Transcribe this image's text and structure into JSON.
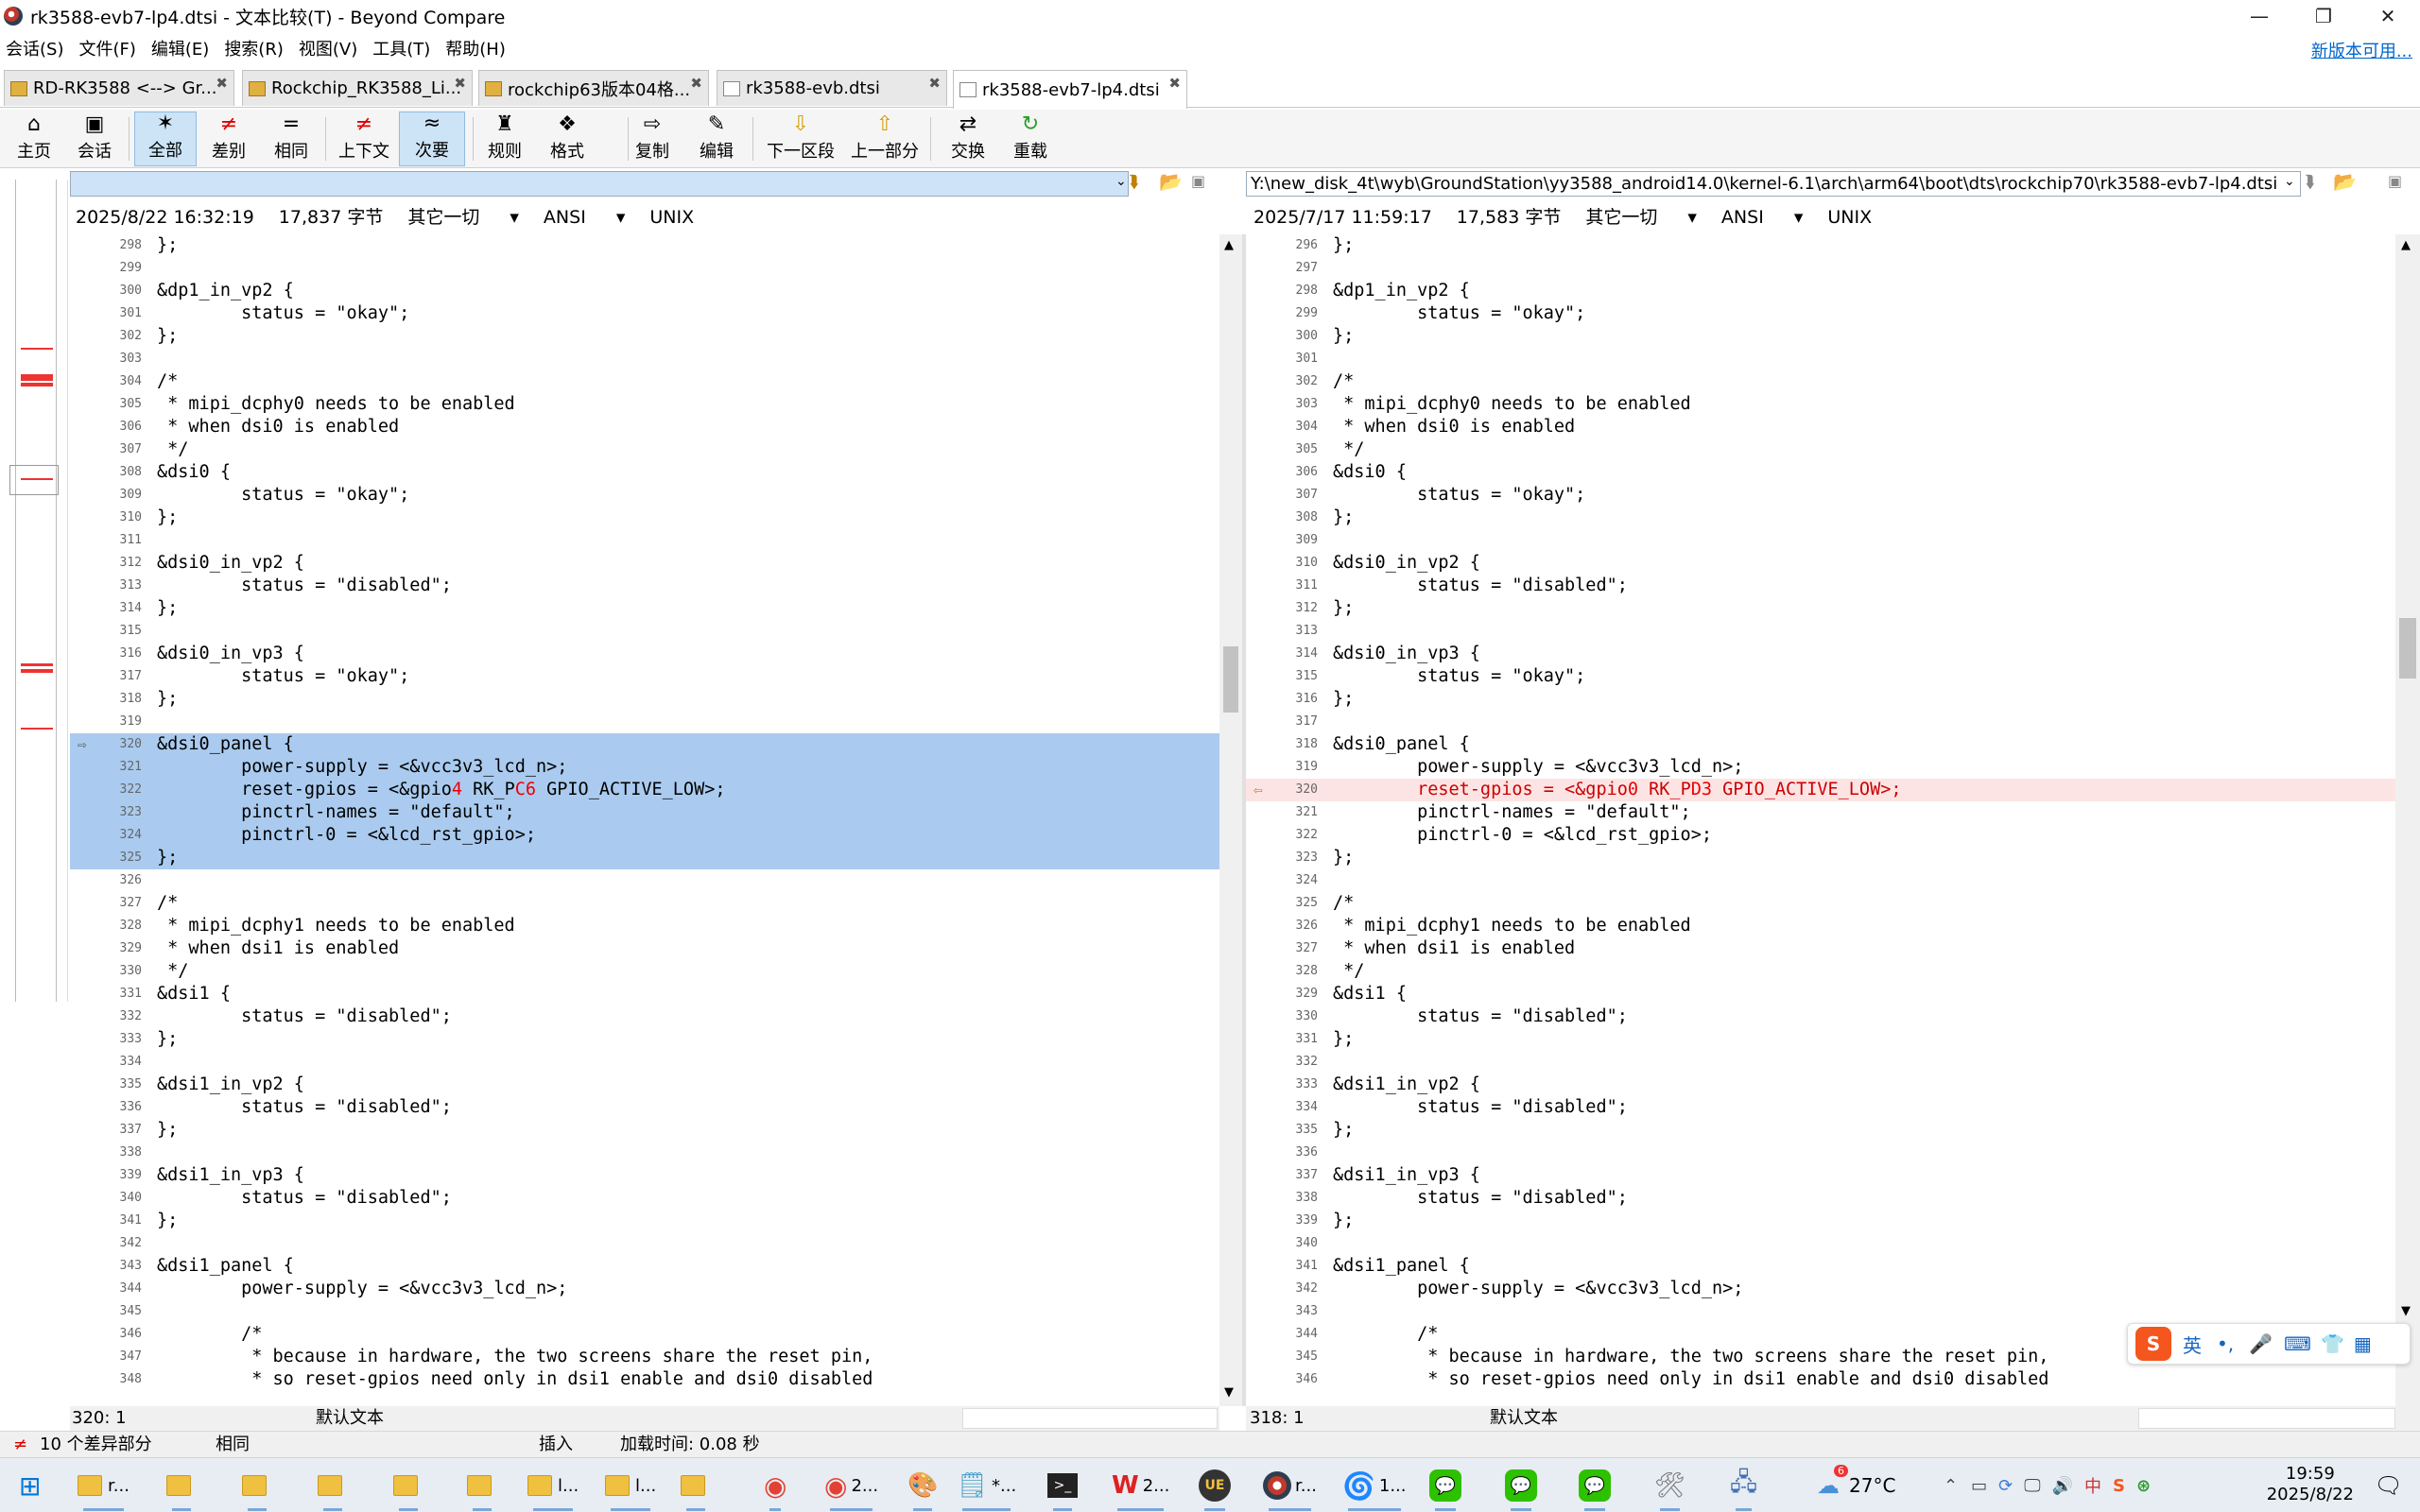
{
  "window": {
    "title": "rk3588-evb7-lp4.dtsi - 文本比较(T) - Beyond Compare"
  },
  "menu": [
    "会话(S)",
    "文件(F)",
    "编辑(E)",
    "搜索(R)",
    "视图(V)",
    "工具(T)",
    "帮助(H)"
  ],
  "update_link": "新版本可用...",
  "tabs": [
    "RD-RK3588 <--> Gr...",
    "Rockchip_RK3588_Li...",
    "rockchip63版本04格...",
    "rk3588-evb.dtsi",
    "rk3588-evb7-lp4.dtsi"
  ],
  "toolbar": [
    {
      "label": "主页",
      "icon": "⌂"
    },
    {
      "label": "会话",
      "icon": "▣"
    },
    {
      "label": "全部",
      "icon": "✶"
    },
    {
      "label": "差别",
      "icon": "≠"
    },
    {
      "label": "相同",
      "icon": "="
    },
    {
      "label": "上下文",
      "icon": "≠"
    },
    {
      "label": "次要",
      "icon": "≈"
    },
    {
      "label": "规则",
      "icon": "♜"
    },
    {
      "label": "格式",
      "icon": "❖"
    },
    {
      "label": "复制",
      "icon": "⇨"
    },
    {
      "label": "编辑",
      "icon": "✎"
    },
    {
      "label": "下一区段",
      "icon": "⇩"
    },
    {
      "label": "上一部分",
      "icon": "⇧"
    },
    {
      "label": "交换",
      "icon": "⇄"
    },
    {
      "label": "重载",
      "icon": "↻"
    }
  ],
  "left": {
    "path": "",
    "date": "2025/8/22 16:32:19",
    "size": "17,837 字节",
    "filter": "其它一切",
    "encoding": "ANSI",
    "eol": "UNIX",
    "pos": "320: 1",
    "mode": "默认文本"
  },
  "right": {
    "path": "Y:\\new_disk_4t\\wyb\\GroundStation\\yy3588_android14.0\\kernel-6.1\\arch\\arm64\\boot\\dts\\rockchip70\\rk3588-evb7-lp4.dtsi",
    "date": "2025/7/17 11:59:17",
    "size": "17,583 字节",
    "filter": "其它一切",
    "encoding": "ANSI",
    "eol": "UNIX",
    "pos": "318: 1",
    "mode": "默认文本"
  },
  "left_lines": [
    {
      "n": "298",
      "t": "};"
    },
    {
      "n": "299",
      "t": ""
    },
    {
      "n": "300",
      "t": "&dp1_in_vp2 {"
    },
    {
      "n": "301",
      "t": "        status = \"okay\";"
    },
    {
      "n": "302",
      "t": "};"
    },
    {
      "n": "303",
      "t": ""
    },
    {
      "n": "304",
      "t": "/*"
    },
    {
      "n": "305",
      "t": " * mipi_dcphy0 needs to be enabled"
    },
    {
      "n": "306",
      "t": " * when dsi0 is enabled"
    },
    {
      "n": "307",
      "t": " */"
    },
    {
      "n": "308",
      "t": "&dsi0 {"
    },
    {
      "n": "309",
      "t": "        status = \"okay\";"
    },
    {
      "n": "310",
      "t": "};"
    },
    {
      "n": "311",
      "t": ""
    },
    {
      "n": "312",
      "t": "&dsi0_in_vp2 {"
    },
    {
      "n": "313",
      "t": "        status = \"disabled\";"
    },
    {
      "n": "314",
      "t": "};"
    },
    {
      "n": "315",
      "t": ""
    },
    {
      "n": "316",
      "t": "&dsi0_in_vp3 {"
    },
    {
      "n": "317",
      "t": "        status = \"okay\";"
    },
    {
      "n": "318",
      "t": "};"
    },
    {
      "n": "319",
      "t": ""
    },
    {
      "n": "320",
      "t": "&dsi0_panel {",
      "sel": true
    },
    {
      "n": "321",
      "t": "        power-supply = <&vcc3v3_lcd_n>;",
      "sel": true
    },
    {
      "n": "322",
      "t": "        reset-gpios = <&gpio",
      "m1": "4",
      "t2": " RK_P",
      "m2": "C6",
      "t3": " GPIO_ACTIVE_LOW>;",
      "sel": true
    },
    {
      "n": "323",
      "t": "        pinctrl-names = \"default\";",
      "sel": true
    },
    {
      "n": "324",
      "t": "        pinctrl-0 = <&lcd_rst_gpio>;",
      "sel": true
    },
    {
      "n": "325",
      "t": "};",
      "sel": true
    },
    {
      "n": "326",
      "t": ""
    },
    {
      "n": "327",
      "t": "/*"
    },
    {
      "n": "328",
      "t": " * mipi_dcphy1 needs to be enabled"
    },
    {
      "n": "329",
      "t": " * when dsi1 is enabled"
    },
    {
      "n": "330",
      "t": " */"
    },
    {
      "n": "331",
      "t": "&dsi1 {"
    },
    {
      "n": "332",
      "t": "        status = \"disabled\";"
    },
    {
      "n": "333",
      "t": "};"
    },
    {
      "n": "334",
      "t": ""
    },
    {
      "n": "335",
      "t": "&dsi1_in_vp2 {"
    },
    {
      "n": "336",
      "t": "        status = \"disabled\";"
    },
    {
      "n": "337",
      "t": "};"
    },
    {
      "n": "338",
      "t": ""
    },
    {
      "n": "339",
      "t": "&dsi1_in_vp3 {"
    },
    {
      "n": "340",
      "t": "        status = \"disabled\";"
    },
    {
      "n": "341",
      "t": "};"
    },
    {
      "n": "342",
      "t": ""
    },
    {
      "n": "343",
      "t": "&dsi1_panel {"
    },
    {
      "n": "344",
      "t": "        power-supply = <&vcc3v3_lcd_n>;"
    },
    {
      "n": "345",
      "t": ""
    },
    {
      "n": "346",
      "t": "        /*"
    },
    {
      "n": "347",
      "t": "         * because in hardware, the two screens share the reset pin,"
    },
    {
      "n": "348",
      "t": "         * so reset-gpios need only in dsi1 enable and dsi0 disabled"
    }
  ],
  "right_lines": [
    {
      "n": "296",
      "t": "};"
    },
    {
      "n": "297",
      "t": ""
    },
    {
      "n": "298",
      "t": "&dp1_in_vp2 {"
    },
    {
      "n": "299",
      "t": "        status = \"okay\";"
    },
    {
      "n": "300",
      "t": "};"
    },
    {
      "n": "301",
      "t": ""
    },
    {
      "n": "302",
      "t": "/*"
    },
    {
      "n": "303",
      "t": " * mipi_dcphy0 needs to be enabled"
    },
    {
      "n": "304",
      "t": " * when dsi0 is enabled"
    },
    {
      "n": "305",
      "t": " */"
    },
    {
      "n": "306",
      "t": "&dsi0 {"
    },
    {
      "n": "307",
      "t": "        status = \"okay\";"
    },
    {
      "n": "308",
      "t": "};"
    },
    {
      "n": "309",
      "t": ""
    },
    {
      "n": "310",
      "t": "&dsi0_in_vp2 {"
    },
    {
      "n": "311",
      "t": "        status = \"disabled\";"
    },
    {
      "n": "312",
      "t": "};"
    },
    {
      "n": "313",
      "t": ""
    },
    {
      "n": "314",
      "t": "&dsi0_in_vp3 {"
    },
    {
      "n": "315",
      "t": "        status = \"okay\";"
    },
    {
      "n": "316",
      "t": "};"
    },
    {
      "n": "317",
      "t": ""
    },
    {
      "n": "318",
      "t": "&dsi0_panel {"
    },
    {
      "n": "319",
      "t": "        power-supply = <&vcc3v3_lcd_n>;"
    },
    {
      "n": "320",
      "t": "        reset-gpios = <&gpio",
      "m1": "0",
      "t2": " RK_P",
      "m2": "D3",
      "t3": " GPIO_ACTIVE_LOW>;",
      "diff": true
    },
    {
      "n": "321",
      "t": "        pinctrl-names = \"default\";"
    },
    {
      "n": "322",
      "t": "        pinctrl-0 = <&lcd_rst_gpio>;"
    },
    {
      "n": "323",
      "t": "};"
    },
    {
      "n": "324",
      "t": ""
    },
    {
      "n": "325",
      "t": "/*"
    },
    {
      "n": "326",
      "t": " * mipi_dcphy1 needs to be enabled"
    },
    {
      "n": "327",
      "t": " * when dsi1 is enabled"
    },
    {
      "n": "328",
      "t": " */"
    },
    {
      "n": "329",
      "t": "&dsi1 {"
    },
    {
      "n": "330",
      "t": "        status = \"disabled\";"
    },
    {
      "n": "331",
      "t": "};"
    },
    {
      "n": "332",
      "t": ""
    },
    {
      "n": "333",
      "t": "&dsi1_in_vp2 {"
    },
    {
      "n": "334",
      "t": "        status = \"disabled\";"
    },
    {
      "n": "335",
      "t": "};"
    },
    {
      "n": "336",
      "t": ""
    },
    {
      "n": "337",
      "t": "&dsi1_in_vp3 {"
    },
    {
      "n": "338",
      "t": "        status = \"disabled\";"
    },
    {
      "n": "339",
      "t": "};"
    },
    {
      "n": "340",
      "t": ""
    },
    {
      "n": "341",
      "t": "&dsi1_panel {"
    },
    {
      "n": "342",
      "t": "        power-supply = <&vcc3v3_lcd_n>;"
    },
    {
      "n": "343",
      "t": ""
    },
    {
      "n": "344",
      "t": "        /*"
    },
    {
      "n": "345",
      "t": "         * because in hardware, the two screens share the reset pin,"
    },
    {
      "n": "346",
      "t": "         * so reset-gpios need only in dsi1 enable and dsi0 disabled"
    }
  ],
  "status": {
    "diffs": "10 个差异部分",
    "same": "相同",
    "insert": "插入",
    "load": "加载时间: 0.08 秒"
  },
  "ime": {
    "lang": "英"
  },
  "taskbar": {
    "items": [
      "r...",
      "2...",
      "*...",
      "2...",
      "r...",
      "1..."
    ],
    "weather": "27°C",
    "time": "19:59",
    "date": "2025/8/22",
    "badge": "6"
  }
}
